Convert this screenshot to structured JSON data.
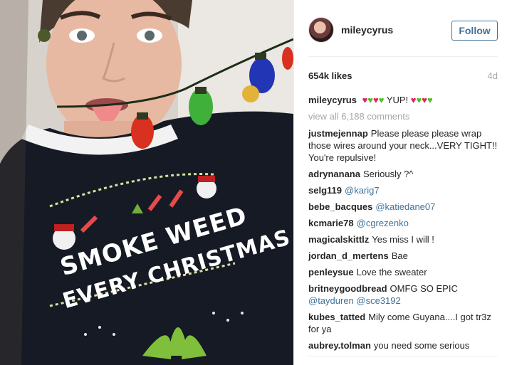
{
  "post": {
    "username": "mileycyrus",
    "follow_label": "Follow",
    "likes": "654k likes",
    "age": "4d",
    "sweater_text": {
      "line1": "SMOKE WEED",
      "line2": "EVERY CHRISTMAS"
    }
  },
  "caption": {
    "user": "mileycyrus",
    "hearts_before": [
      "red",
      "green",
      "red",
      "green"
    ],
    "text": "YUP!",
    "hearts_after": [
      "red",
      "green",
      "red",
      "green"
    ]
  },
  "view_all": "view all 6,188 comments",
  "comments": [
    {
      "user": "justmejennap",
      "text": "Please please please wrap those wires around your neck...VERY TIGHT!! You're repulsive!"
    },
    {
      "user": "adrynanana",
      "text": "Seriously ?^"
    },
    {
      "user": "selg119",
      "mention": "@karig7"
    },
    {
      "user": "bebe_bacques",
      "mention": "@katiedane07"
    },
    {
      "user": "kcmarie78",
      "mention": "@cgrezenko"
    },
    {
      "user": "magicalskittlz",
      "text": "Yes miss I will !"
    },
    {
      "user": "jordan_d_mertens",
      "text": "Bae"
    },
    {
      "user": "penleysue",
      "text": "Love the sweater"
    },
    {
      "user": "britneygoodbread",
      "text": "OMFG SO EPIC",
      "mention": "@tayduren @sce3192"
    },
    {
      "user": "kubes_tatted",
      "text": "Mily come Guyana....I got tr3z for ya"
    },
    {
      "user": "aubrey.tolman",
      "text": "you need some serious"
    }
  ],
  "colors": {
    "link": "#3f729b",
    "muted": "#a5a7aa",
    "heart_red": "#e0245e",
    "heart_green": "#4fbf26",
    "sweater": "#161a24"
  }
}
